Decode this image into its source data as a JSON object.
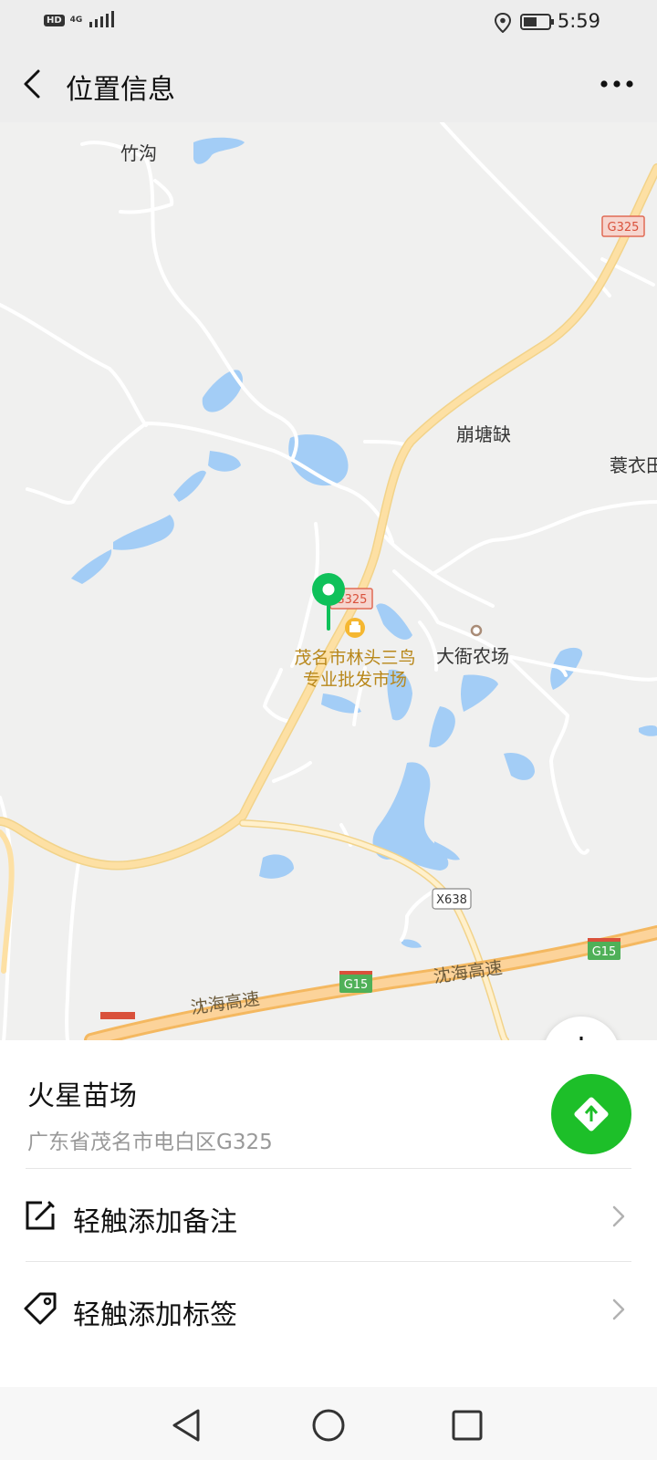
{
  "status_bar": {
    "badge": "HD",
    "network": "4G",
    "time": "5:59",
    "icons": [
      "hd-badge-icon",
      "signal-icon",
      "location-icon",
      "battery-icon"
    ]
  },
  "header": {
    "title": "位置信息",
    "back_icon": "chevron-left-icon",
    "more_icon": "more-dots-icon"
  },
  "map": {
    "place_labels": [
      "竹沟",
      "崩塘缺",
      "蓑衣田",
      "大衙农场"
    ],
    "poi": {
      "line1": "茂名市林头三鸟",
      "line2": "专业批发市场"
    },
    "road_shields": {
      "g325_a": "G325",
      "g325_b": "G325",
      "g15_a": "G15",
      "g15_b": "G15",
      "x638": "X638"
    },
    "expressway_labels": [
      "沈海高速",
      "沈海高速"
    ],
    "colors": {
      "marker": "#0fc15a",
      "water": "#a3cdf6",
      "highway": "#fde0a4",
      "background": "#f0f0ef"
    }
  },
  "place": {
    "name": "火星苗场",
    "address": "广东省茂名市电白区G325"
  },
  "actions": {
    "add_note": "轻触添加备注",
    "add_tag": "轻触添加标签"
  },
  "colors": {
    "nav_button": "#1dbf29"
  }
}
